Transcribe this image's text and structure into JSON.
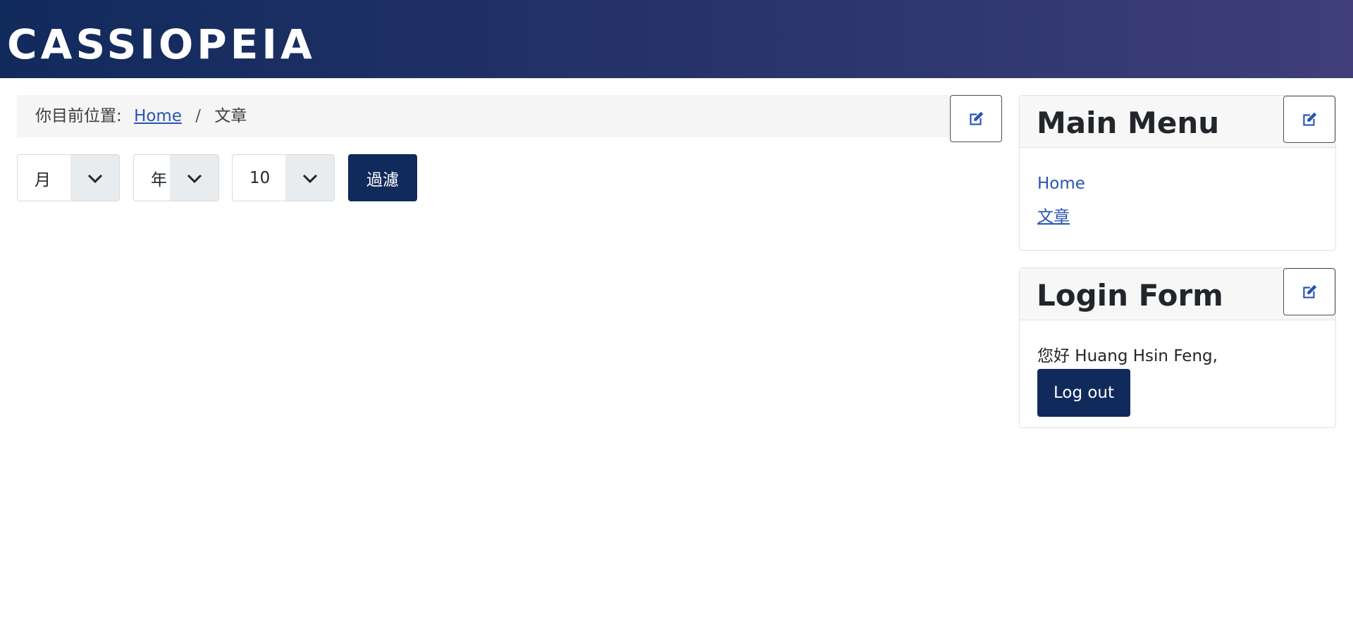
{
  "site": {
    "brand": "CASSIOPEIA"
  },
  "breadcrumb": {
    "prefix": "你目前位置:",
    "items": [
      {
        "label": "Home"
      },
      {
        "label": "文章"
      }
    ],
    "separator": "/"
  },
  "filters": {
    "month": {
      "selected": "月"
    },
    "year": {
      "selected": "年"
    },
    "limit": {
      "selected": "10"
    },
    "submit_label": "過濾"
  },
  "main_menu": {
    "title": "Main Menu",
    "items": [
      {
        "label": "Home"
      },
      {
        "label": "文章"
      }
    ]
  },
  "login_form": {
    "title": "Login Form",
    "greeting": "您好 Huang Hsin Feng,",
    "logout_label": "Log out"
  },
  "icons": {
    "edit": "edit-icon",
    "dropdown": "chevron-down-icon"
  },
  "colors": {
    "header_start": "#112a5c",
    "header_end": "#3f3e7a",
    "primary_button": "#112a5c",
    "link": "#2a54b3"
  }
}
